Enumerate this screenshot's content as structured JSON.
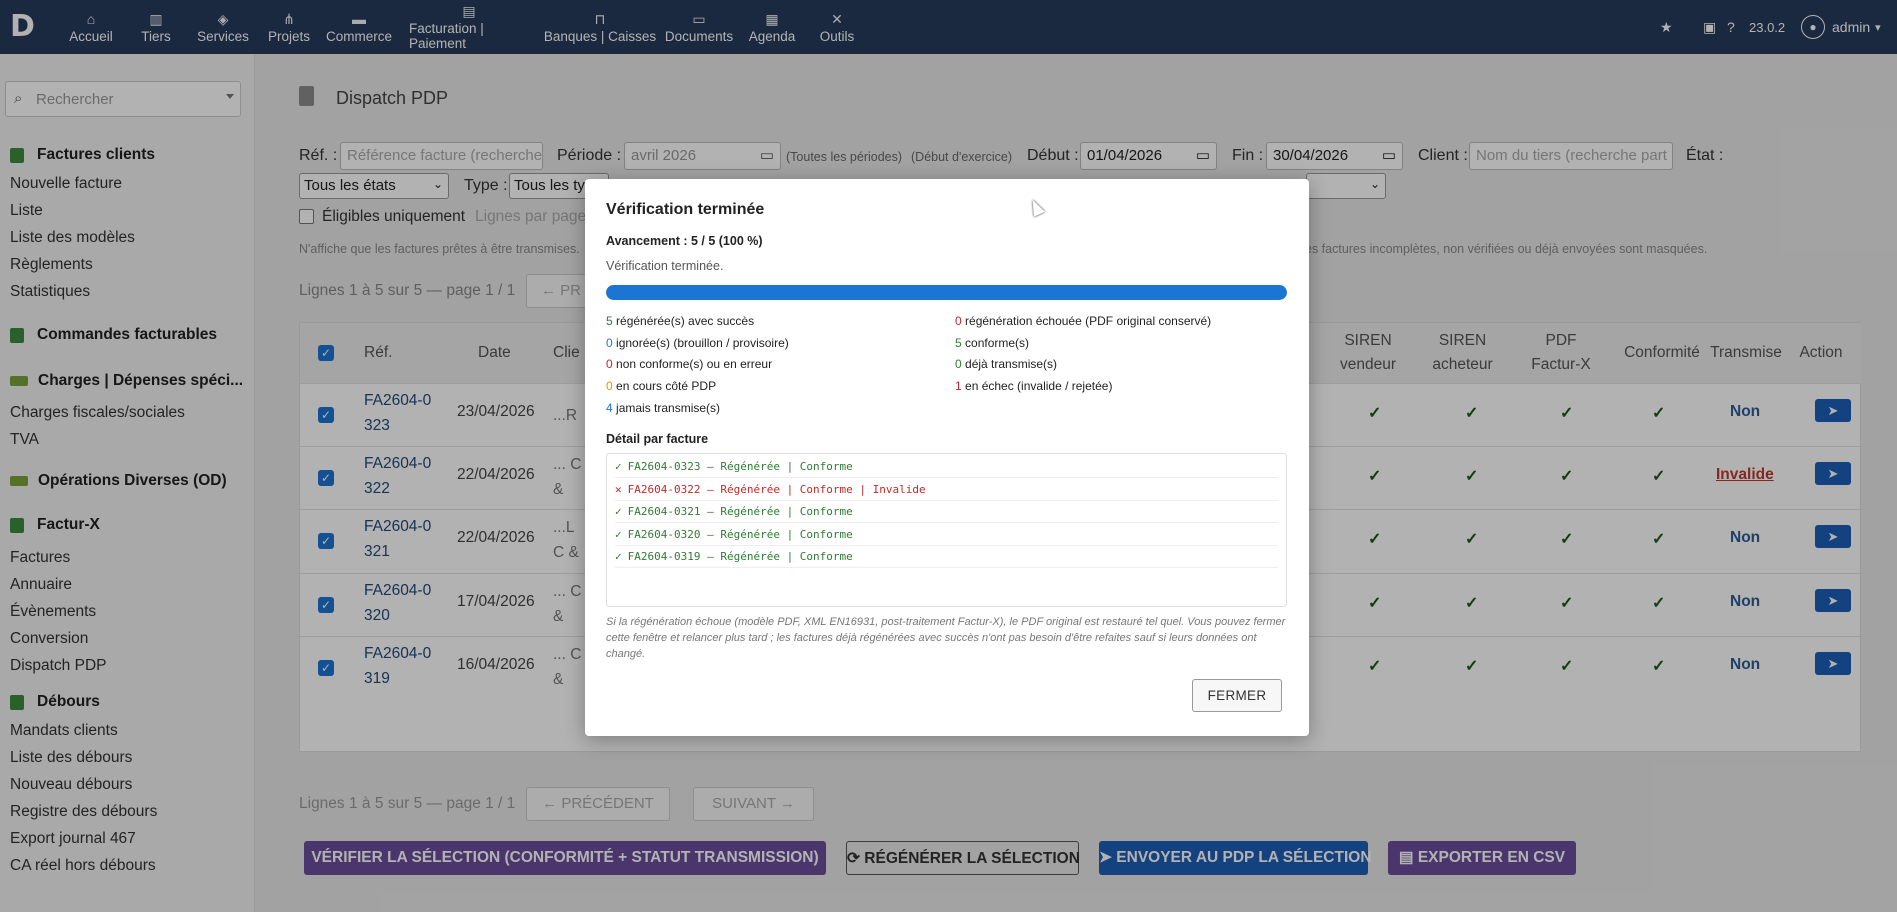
{
  "topbar": {
    "logo": "D",
    "nav": [
      {
        "label": "Accueil",
        "icon": "home-icon",
        "glyph": "⌂"
      },
      {
        "label": "Tiers",
        "icon": "building-icon",
        "glyph": "▥"
      },
      {
        "label": "Services",
        "icon": "cube-icon",
        "glyph": "◈"
      },
      {
        "label": "Projets",
        "icon": "sitemap-icon",
        "glyph": "⋔"
      },
      {
        "label": "Commerce",
        "icon": "briefcase-icon",
        "glyph": "▬"
      },
      {
        "label": "Facturation | Paiement",
        "icon": "invoice-icon",
        "glyph": "▤"
      },
      {
        "label": "Banques | Caisses",
        "icon": "bank-icon",
        "glyph": "⊓"
      },
      {
        "label": "Documents",
        "icon": "folder-icon",
        "glyph": "▭"
      },
      {
        "label": "Agenda",
        "icon": "calendar-icon",
        "glyph": "▦"
      },
      {
        "label": "Outils",
        "icon": "tools-icon",
        "glyph": "✕"
      }
    ],
    "version": "23.0.2",
    "user": "admin"
  },
  "sidebar": {
    "search_placeholder": "Rechercher",
    "sections": [
      {
        "title": "Factures clients",
        "items": [
          "Nouvelle facture",
          "Liste",
          "Liste des modèles",
          "Règlements",
          "Statistiques"
        ]
      },
      {
        "title": "Commandes facturables",
        "items": []
      },
      {
        "title": "Charges | Dépenses spéci...",
        "items": [
          "Charges fiscales/sociales",
          "TVA"
        ]
      },
      {
        "title": "Opérations Diverses (OD)",
        "items": []
      },
      {
        "title": "Factur-X",
        "items": [
          "Factures",
          "Annuaire",
          "Évènements",
          "Conversion",
          "Dispatch PDP"
        ]
      },
      {
        "title": "Débours",
        "items": [
          "Mandats clients",
          "Liste des débours",
          "Nouveau débours",
          "Registre des débours",
          "Export journal 467",
          "CA réel hors débours"
        ]
      }
    ]
  },
  "page": {
    "title": "Dispatch PDP",
    "filters": {
      "ref_label": "Réf. :",
      "ref_placeholder": "Référence facture (recherche",
      "periode_label": "Période :",
      "periode_value": "avril 2026",
      "toutes_periodes": "(Toutes les périodes)",
      "debut_exercice": "(Début d'exercice)",
      "debut_label": "Début :",
      "debut_value": "01/04/2026",
      "fin_label": "Fin :",
      "fin_value": "30/04/2026",
      "client_label": "Client :",
      "client_placeholder": "Nom du tiers (recherche part",
      "etat_label": "État :",
      "etat_value": "Tous les états",
      "type_label": "Type :",
      "type_value": "Tous les ty",
      "eligibles_label": "Éligibles uniquement",
      "lignes_label": "Lignes par page"
    },
    "info_left": "N'affiche que les factures prêtes à être transmises.",
    "info_right": "es factures incomplètes, non vérifiées ou déjà envoyées sont masquées.",
    "pagination_top": "Lignes 1 à 5 sur 5 — page 1 / 1",
    "prev_short": "← PR",
    "table": {
      "headers": {
        "ref": "Réf.",
        "date": "Date",
        "client": "Clie",
        "siren_v": "SIREN vendeur",
        "siren_a": "SIREN acheteur",
        "pdf": "PDF Factur-X",
        "conf": "Conformité",
        "trans": "Transmise",
        "action": "Action"
      },
      "rows": [
        {
          "ref": "FA2604-0323",
          "date": "23/04/2026",
          "client": "...R",
          "trans": "Non",
          "check": "✓"
        },
        {
          "ref": "FA2604-0322",
          "date": "22/04/2026",
          "client": "... C & OF",
          "trans": "Invalide",
          "check": "✓"
        },
        {
          "ref": "FA2604-0321",
          "date": "22/04/2026",
          "client": "...L C & OF",
          "trans": "Non",
          "check": "✓"
        },
        {
          "ref": "FA2604-0320",
          "date": "17/04/2026",
          "client": "... C & OF",
          "trans": "Non",
          "check": "✓"
        },
        {
          "ref": "FA2604-0319",
          "date": "16/04/2026",
          "client": "... C & OF",
          "trans": "Non",
          "check": "✓"
        }
      ]
    },
    "pagination_bottom": "Lignes 1 à 5 sur 5 — page 1 / 1",
    "prev": "← PRÉCÉDENT",
    "next": "SUIVANT →",
    "actions": {
      "verify": "VÉRIFIER LA SÉLECTION (CONFORMITÉ + STATUT TRANSMISSION)",
      "regen": "RÉGÉNÉRER LA SÉLECTION",
      "send": "ENVOYER AU PDP LA SÉLECTION",
      "export": "EXPORTER EN CSV"
    }
  },
  "modal": {
    "title": "Vérification terminée",
    "progress": "Avancement : 5 / 5 (100 %)",
    "progress_fraction": 1.0,
    "status": "Vérification terminée.",
    "stats_left": [
      {
        "n": "5",
        "text": " régénérée(s) avec succès",
        "color": "#2e7d32"
      },
      {
        "n": "0",
        "text": " ignorée(s) (brouillon / provisoire)",
        "color": "#1c75d3"
      },
      {
        "n": "0",
        "text": " non conforme(s) ou en erreur",
        "color": "#c62828"
      },
      {
        "n": "0",
        "text": " en cours côté PDP",
        "color": "#e69500"
      },
      {
        "n": "4",
        "text": " jamais transmise(s)",
        "color": "#1c75d3"
      }
    ],
    "stats_right": [
      {
        "n": "0",
        "text": " régénération échouée (PDF original conservé)",
        "color": "#c62828"
      },
      {
        "n": "5",
        "text": " conforme(s)",
        "color": "#2e7d32"
      },
      {
        "n": "0",
        "text": " déjà transmise(s)",
        "color": "#2e7d32"
      },
      {
        "n": "1",
        "text": " en échec (invalide / rejetée)",
        "color": "#c62828"
      }
    ],
    "detail_title": "Détail par facture",
    "details": [
      {
        "mark": "✓",
        "text": "FA2604-0323 — Régénérée | Conforme",
        "ok": true
      },
      {
        "mark": "✕",
        "text": "FA2604-0322 — Régénérée | Conforme | Invalide",
        "ok": false
      },
      {
        "mark": "✓",
        "text": "FA2604-0321 — Régénérée | Conforme",
        "ok": true
      },
      {
        "mark": "✓",
        "text": "FA2604-0320 — Régénérée | Conforme",
        "ok": true
      },
      {
        "mark": "✓",
        "text": "FA2604-0319 — Régénérée | Conforme",
        "ok": true
      }
    ],
    "note": "Si la régénération échoue (modèle PDF, XML EN16931, post-traitement Factur-X), le PDF original est restauré tel quel. Vous pouvez fermer cette fenêtre et relancer plus tard ; les factures déjà régénérées avec succès n'ont pas besoin d'être refaites sauf si leurs données ont changé.",
    "close": "FERMER"
  }
}
